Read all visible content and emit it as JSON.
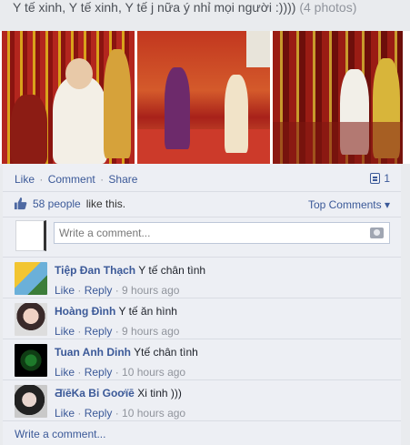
{
  "post": {
    "caption": "Y tế xinh, Y tế xinh, Y tế j nữa ý nhỉ mọi người :))))",
    "photo_count": "(4 photos)"
  },
  "actions": {
    "like": "Like",
    "comment": "Comment",
    "share": "Share",
    "shares": "1",
    "sep": "·"
  },
  "likes": {
    "people": "58 people",
    "suffix": "like this.",
    "sort": "Top Comments ▾"
  },
  "composer": {
    "placeholder": "Write a comment..."
  },
  "comments": [
    {
      "author": "Tiệp Đan Thạch",
      "text": "Y tế chân tình",
      "like": "Like",
      "reply": "Reply",
      "time": "9 hours ago"
    },
    {
      "author": "Hoàng Đình",
      "text": "Y tế ăn hình",
      "like": "Like",
      "reply": "Reply",
      "time": "9 hours ago"
    },
    {
      "author": "Tuan Anh Dinh",
      "text": "Ytế chân tình",
      "like": "Like",
      "reply": "Reply",
      "time": "10 hours ago"
    },
    {
      "author": "ƋïēKa Bi Goơïē",
      "text": "Xi tinh )))",
      "like": "Like",
      "reply": "Reply",
      "time": "10 hours ago"
    }
  ],
  "footer": {
    "write_comment": "Write a comment..."
  },
  "colors": {
    "link": "#3b5998",
    "meta": "#90949c",
    "panel": "#edeff4"
  }
}
